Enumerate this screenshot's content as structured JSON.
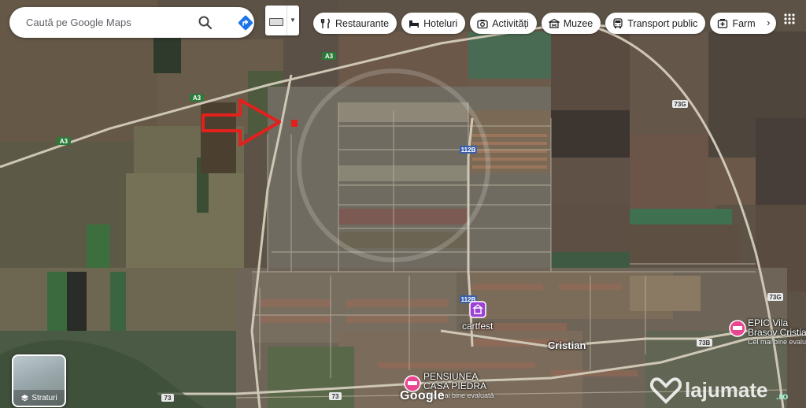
{
  "search": {
    "placeholder": "Caută pe Google Maps"
  },
  "chips": [
    {
      "label": "Restaurante",
      "icon": "fork-knife-icon"
    },
    {
      "label": "Hoteluri",
      "icon": "bed-icon"
    },
    {
      "label": "Activități",
      "icon": "camera-icon"
    },
    {
      "label": "Muzee",
      "icon": "museum-icon"
    },
    {
      "label": "Transport public",
      "icon": "bus-icon"
    },
    {
      "label": "Farm",
      "icon": "pharmacy-icon"
    }
  ],
  "layers": {
    "label": "Straturi"
  },
  "roads": {
    "a3_1": "A3",
    "a3_2": "A3",
    "a3_3": "A3",
    "r73g": "73G",
    "r73g_b": "73G",
    "r112b": "112B",
    "r112b_b": "112B",
    "r73b": "73B",
    "r73": "73",
    "r73a": "73"
  },
  "places": {
    "cartfest": "cartfest",
    "cristian": "Cristian",
    "epic_line1": "EPIC Vila",
    "epic_line2": "Brasov Cristian",
    "epic_sub": "Cel mai bine evalua",
    "pensiunea_line1": "PENSIUNEA",
    "pensiunea_line2": "CASA PIEDRA",
    "pensiunea_sub": "Cea mai bine evaluată"
  },
  "brand": "Google",
  "watermark": "lajumate",
  "watermark_tld": ".ro",
  "colors": {
    "arrow": "#e3211c",
    "poi_pink": "#e8478f",
    "poi_purple": "#9c40d6",
    "road": "#c7c0b1"
  }
}
